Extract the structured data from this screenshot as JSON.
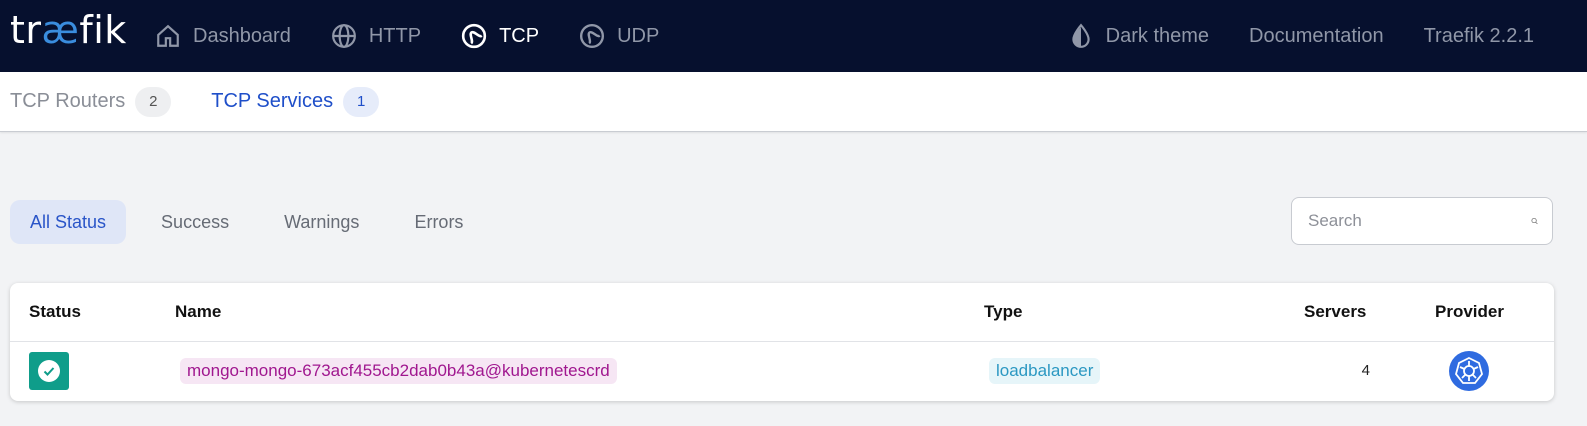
{
  "brand": {
    "logo_prefix": "tr",
    "logo_ae": "æ",
    "logo_suffix": "fik"
  },
  "nav": {
    "left": [
      {
        "label": "Dashboard",
        "icon": "home-icon"
      },
      {
        "label": "HTTP",
        "icon": "globe-icon"
      },
      {
        "label": "TCP",
        "icon": "tcp-icon",
        "active": true
      },
      {
        "label": "UDP",
        "icon": "udp-icon"
      }
    ],
    "right": [
      {
        "label": "Dark theme",
        "icon": "drop-icon"
      },
      {
        "label": "Documentation"
      },
      {
        "label": "Traefik 2.2.1"
      }
    ]
  },
  "subtabs": [
    {
      "label": "TCP Routers",
      "count": "2"
    },
    {
      "label": "TCP Services",
      "count": "1",
      "active": true
    }
  ],
  "filters": [
    "All Status",
    "Success",
    "Warnings",
    "Errors"
  ],
  "search": {
    "placeholder": "Search"
  },
  "table": {
    "headers": {
      "status": "Status",
      "name": "Name",
      "type": "Type",
      "servers": "Servers",
      "provider": "Provider"
    },
    "rows": [
      {
        "status": "success",
        "name": "mongo-mongo-673acf455cb2dab0b43a@kubernetescrd",
        "type": "loadbalancer",
        "servers": "4",
        "provider": "kubernetes-icon"
      }
    ]
  },
  "colors": {
    "nav_bg": "#06102e",
    "accent": "#1f4fc9",
    "success": "#0f9d8a",
    "provider": "#2f6be0"
  }
}
